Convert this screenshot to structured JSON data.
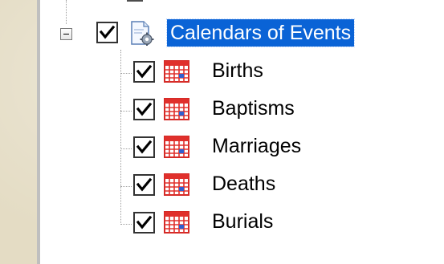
{
  "tree": {
    "parent": {
      "label": "Calendars of Events",
      "checked": true,
      "expanded": true,
      "selected": true,
      "icon": "gear-document-icon"
    },
    "children": [
      {
        "label": "Births",
        "checked": true,
        "icon": "calendar-icon"
      },
      {
        "label": "Baptisms",
        "checked": true,
        "icon": "calendar-icon"
      },
      {
        "label": "Marriages",
        "checked": true,
        "icon": "calendar-icon"
      },
      {
        "label": "Deaths",
        "checked": true,
        "icon": "calendar-icon"
      },
      {
        "label": "Burials",
        "checked": true,
        "icon": "calendar-icon"
      }
    ]
  },
  "colors": {
    "selection": "#0a63d6",
    "selection_text": "#ffffff",
    "calendar_red": "#e0302c",
    "calendar_blue": "#2f5fd0",
    "desktop_bg": "#e4dcc4"
  }
}
